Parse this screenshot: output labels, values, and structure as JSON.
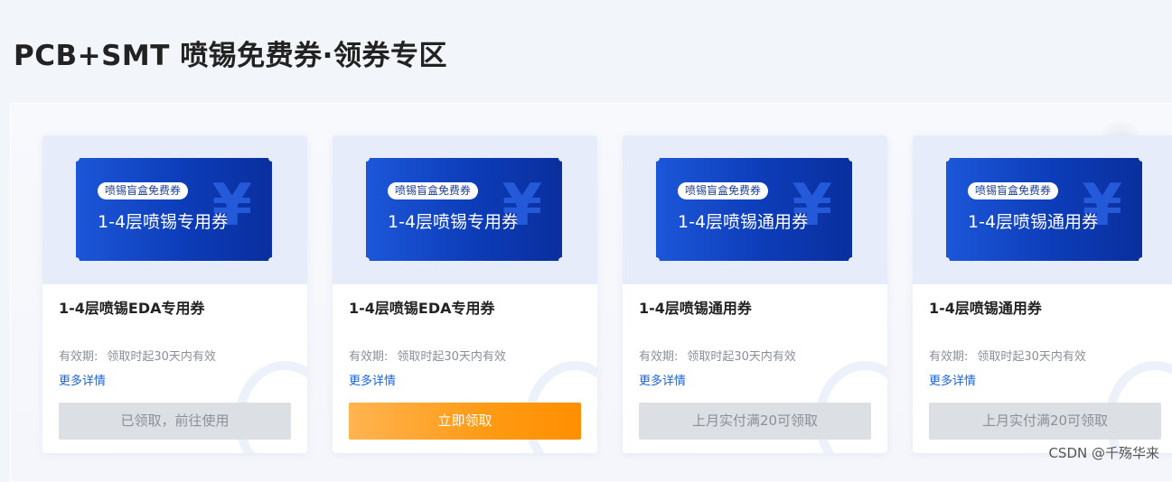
{
  "page": {
    "title": "PCB+SMT 喷锡免费券·领券专区"
  },
  "cards": [
    {
      "badge": "喷锡盲盒免费券",
      "coupon_name": "1-4层喷锡专用券",
      "currency_symbol": "¥",
      "title": "1-4层喷锡EDA专用券",
      "validity_label": "有效期:",
      "validity_value": "领取时起30天内有效",
      "more": "更多详情",
      "button": "已领取，前往使用",
      "button_state": "disabled"
    },
    {
      "badge": "喷锡盲盒免费券",
      "coupon_name": "1-4层喷锡专用券",
      "currency_symbol": "¥",
      "title": "1-4层喷锡EDA专用券",
      "validity_label": "有效期:",
      "validity_value": "领取时起30天内有效",
      "more": "更多详情",
      "button": "立即领取",
      "button_state": "active"
    },
    {
      "badge": "喷锡盲盒免费券",
      "coupon_name": "1-4层喷锡通用券",
      "currency_symbol": "¥",
      "title": "1-4层喷锡通用券",
      "validity_label": "有效期:",
      "validity_value": "领取时起30天内有效",
      "more": "更多详情",
      "button": "上月实付满20可领取",
      "button_state": "disabled"
    },
    {
      "badge": "喷锡盲盒免费券",
      "coupon_name": "1-4层喷锡通用券",
      "currency_symbol": "¥",
      "title": "1-4层喷锡通用券",
      "validity_label": "有效期:",
      "validity_value": "领取时起30天内有效",
      "more": "更多详情",
      "button": "上月实付满20可领取",
      "button_state": "disabled"
    }
  ],
  "watermark": "CSDN @千殇华来",
  "colors": {
    "coupon_blue": "#0d3cb8",
    "action_orange": "#ff9a14",
    "link_blue": "#1a63d8",
    "disabled_gray": "#dcdfe4"
  }
}
